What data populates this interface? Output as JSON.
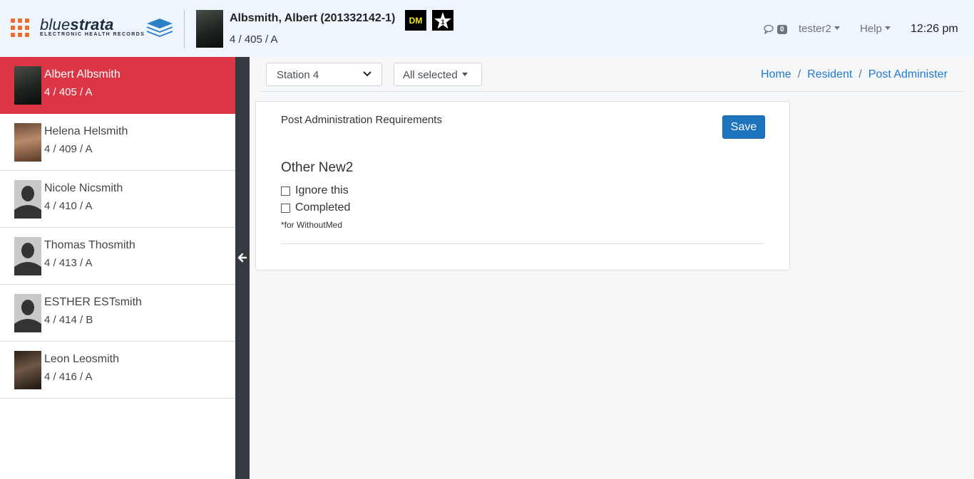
{
  "header": {
    "logo_main": "blue",
    "logo_bold": "strata",
    "logo_sub": "ELECTRONIC HEALTH RECORDS",
    "patient_name": "Albsmith, Albert (201332142-1)",
    "patient_room": "4 / 405 / A",
    "badge_dm": "DM",
    "message_count": "0",
    "user": "tester2",
    "help": "Help",
    "time": "12:26 pm"
  },
  "residents": [
    {
      "name": "Albert Albsmith",
      "room": "4 / 405 / A",
      "active": true,
      "photo": "photo"
    },
    {
      "name": "Helena Helsmith",
      "room": "4 / 409 / A",
      "active": false,
      "photo": "photo"
    },
    {
      "name": "Nicole Nicsmith",
      "room": "4 / 410 / A",
      "active": false,
      "photo": "silhouette"
    },
    {
      "name": "Thomas Thosmith",
      "room": "4 / 413 / A",
      "active": false,
      "photo": "silhouette"
    },
    {
      "name": "ESTHER ESTsmith",
      "room": "4 / 414 / B",
      "active": false,
      "photo": "silhouette"
    },
    {
      "name": "Leon Leosmith",
      "room": "4 / 416 / A",
      "active": false,
      "photo": "photo"
    }
  ],
  "toolbar": {
    "station": "Station 4",
    "filter": "All selected"
  },
  "breadcrumb": [
    "Home",
    "Resident",
    "Post Administer"
  ],
  "card": {
    "title": "Post Administration Requirements",
    "save_label": "Save",
    "heading": "Other New2",
    "options": [
      "Ignore this",
      "Completed"
    ],
    "note": "*for WithoutMed"
  },
  "colors": {
    "accent_red": "#dc3545",
    "primary_blue": "#1e73be",
    "link_blue": "#1e7ad0",
    "apps_orange": "#f06b2c",
    "dark_bar": "#343a40"
  }
}
